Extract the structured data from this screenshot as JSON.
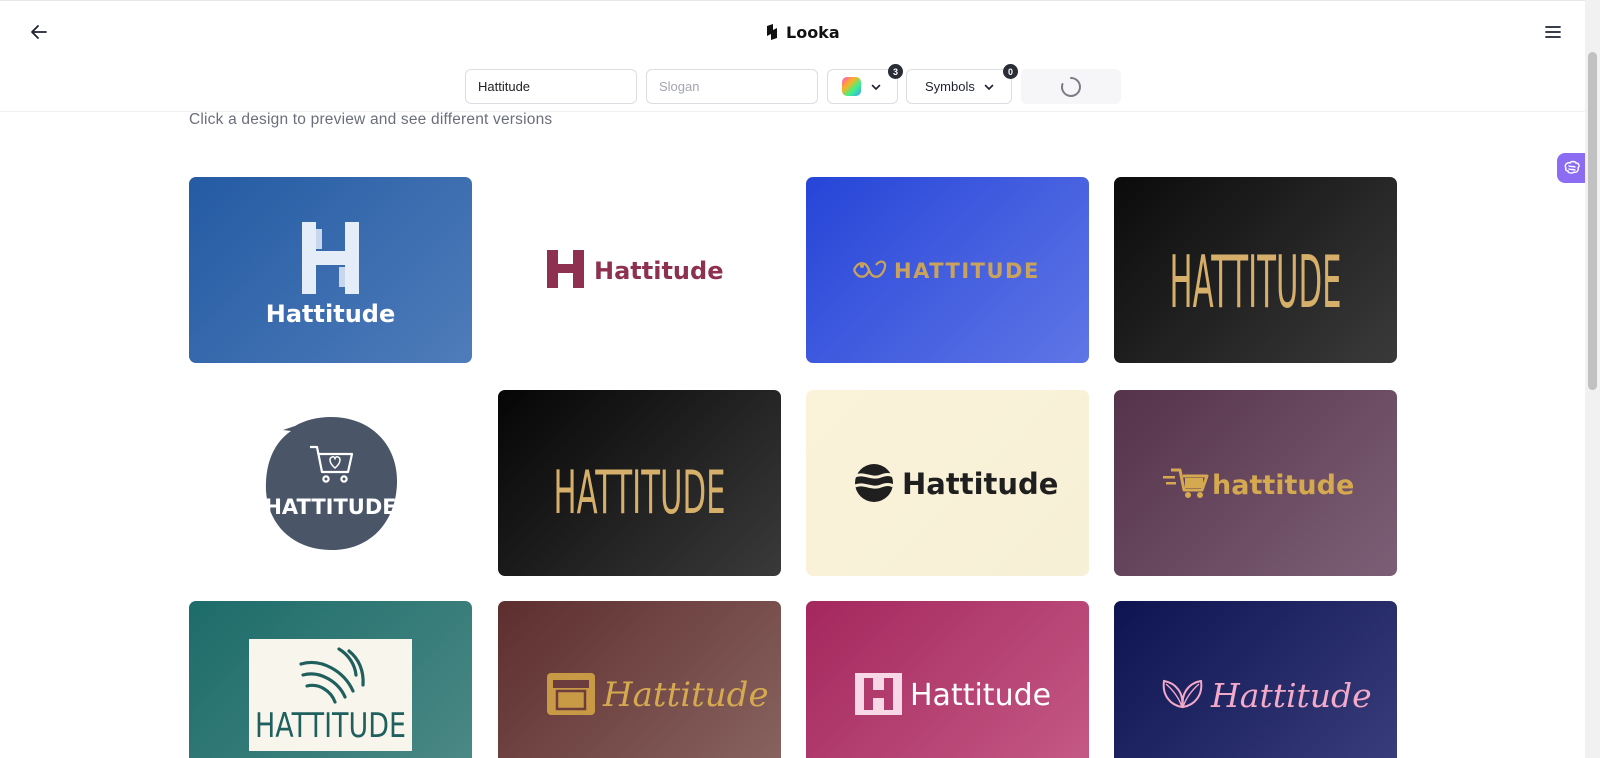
{
  "header": {
    "brand": "Looka",
    "name_value": "Hattitude",
    "slogan_placeholder": "Slogan",
    "colors_count": "3",
    "symbols_label": "Symbols",
    "symbols_count": "0"
  },
  "hint": "Click a design to preview and see different versions",
  "designs": [
    {
      "text": "Hattitude",
      "colors": [
        "#2a5fa8",
        "#ffffff"
      ]
    },
    {
      "text": "Hattitude",
      "colors": [
        "#ffffff",
        "#8e3150"
      ]
    },
    {
      "text": "HATTITUDE",
      "colors": [
        "#2a48da",
        "#c9a35b"
      ]
    },
    {
      "text": "HATTITUDE",
      "colors": [
        "#111111",
        "#d6b06a"
      ]
    },
    {
      "text": "HATTITUDE",
      "colors": [
        "#4a5568",
        "#ffffff"
      ]
    },
    {
      "text": "HATTITUDE",
      "colors": [
        "#111111",
        "#d6b06a"
      ]
    },
    {
      "text": "Hattitude",
      "colors": [
        "#f8f1d8",
        "#1f1f1f"
      ]
    },
    {
      "text": "hattitude",
      "colors": [
        "#664459",
        "#d4a94f"
      ]
    },
    {
      "text": "HATTITUDE",
      "colors": [
        "#23706d",
        "#1f5f5d"
      ]
    },
    {
      "text": "Hattitude",
      "colors": [
        "#6d3d3d",
        "#d4a94f"
      ]
    },
    {
      "text": "Hattitude",
      "colors": [
        "#b23b6e",
        "#ffffff"
      ]
    },
    {
      "text": "Hattitude",
      "colors": [
        "#1a2060",
        "#f3a9c8"
      ]
    }
  ]
}
